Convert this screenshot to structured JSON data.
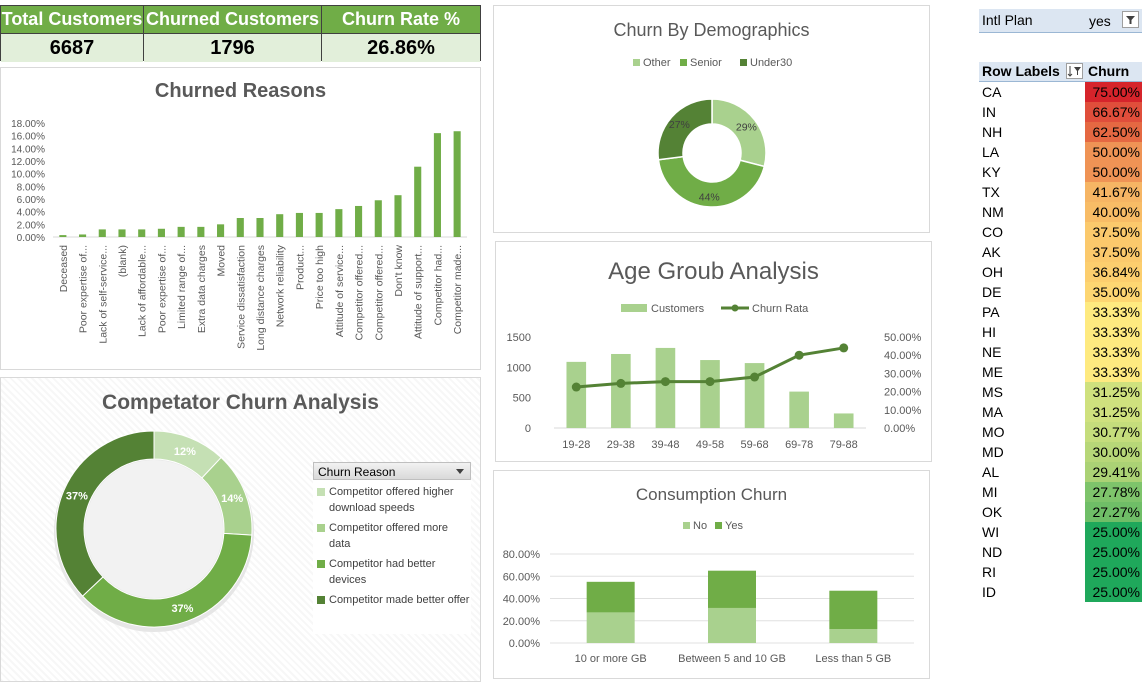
{
  "kpis": [
    {
      "label": "Total Customers",
      "value": "6687"
    },
    {
      "label": "Churned Customers",
      "value": "1796"
    },
    {
      "label": "Churn Rate %",
      "value": "26.86%"
    }
  ],
  "filter": {
    "label": "Intl Plan",
    "value": "yes"
  },
  "pivot": {
    "header_row": "Row Labels",
    "header_value": "Churn",
    "rows": [
      {
        "state": "CA",
        "value": "75.00%",
        "color": "#d6242b"
      },
      {
        "state": "IN",
        "value": "66.67%",
        "color": "#e04e3b"
      },
      {
        "state": "NH",
        "value": "62.50%",
        "color": "#e56842"
      },
      {
        "state": "LA",
        "value": "50.00%",
        "color": "#ef9355"
      },
      {
        "state": "KY",
        "value": "50.00%",
        "color": "#ef9355"
      },
      {
        "state": "TX",
        "value": "41.67%",
        "color": "#f6b564"
      },
      {
        "state": "NM",
        "value": "40.00%",
        "color": "#f8bc66"
      },
      {
        "state": "CO",
        "value": "37.50%",
        "color": "#fbc96c"
      },
      {
        "state": "AK",
        "value": "37.50%",
        "color": "#fbc96c"
      },
      {
        "state": "OH",
        "value": "36.84%",
        "color": "#fcce6e"
      },
      {
        "state": "DE",
        "value": "35.00%",
        "color": "#fdd672"
      },
      {
        "state": "PA",
        "value": "33.33%",
        "color": "#feea80"
      },
      {
        "state": "HI",
        "value": "33.33%",
        "color": "#feea80"
      },
      {
        "state": "NE",
        "value": "33.33%",
        "color": "#feea80"
      },
      {
        "state": "ME",
        "value": "33.33%",
        "color": "#feea80"
      },
      {
        "state": "MS",
        "value": "31.25%",
        "color": "#cfe17e"
      },
      {
        "state": "MA",
        "value": "31.25%",
        "color": "#cfe17e"
      },
      {
        "state": "MO",
        "value": "30.77%",
        "color": "#c5dd7c"
      },
      {
        "state": "MD",
        "value": "30.00%",
        "color": "#b7d778"
      },
      {
        "state": "AL",
        "value": "29.41%",
        "color": "#abd275"
      },
      {
        "state": "MI",
        "value": "27.78%",
        "color": "#7ec46b"
      },
      {
        "state": "OK",
        "value": "27.27%",
        "color": "#6fbe67"
      },
      {
        "state": "WI",
        "value": "25.00%",
        "color": "#1fa85b"
      },
      {
        "state": "ND",
        "value": "25.00%",
        "color": "#1fa85b"
      },
      {
        "state": "RI",
        "value": "25.00%",
        "color": "#1fa85b"
      },
      {
        "state": "ID",
        "value": "25.00%",
        "color": "#1fa85b"
      }
    ]
  },
  "chart_data": [
    {
      "id": "churned_reasons",
      "type": "bar",
      "title": "Churned Reasons",
      "color": "#70ad47",
      "categories": [
        "Deceased",
        "Poor expertise of...",
        "Lack of self-service...",
        "(blank)",
        "Lack of affordable...",
        "Poor expertise of...",
        "Limited range of...",
        "Extra data charges",
        "Moved",
        "Service dissatisfaction",
        "Long distance charges",
        "Network reliability",
        "Product...",
        "Price too high",
        "Attitude of service...",
        "Competitor offered...",
        "Competitor offered...",
        "Don't know",
        "Attitude of support...",
        "Competitor had...",
        "Competitor made..."
      ],
      "values": [
        0.3,
        0.4,
        1.2,
        1.2,
        1.2,
        1.3,
        1.6,
        1.6,
        2.0,
        3.0,
        3.0,
        3.6,
        3.8,
        3.8,
        4.4,
        4.9,
        5.8,
        6.6,
        11.1,
        16.4,
        16.7
      ],
      "ylim": [
        0,
        18
      ],
      "yticks": [
        "0.00%",
        "2.00%",
        "4.00%",
        "6.00%",
        "8.00%",
        "10.00%",
        "12.00%",
        "14.00%",
        "16.00%",
        "18.00%"
      ],
      "grid": false
    },
    {
      "id": "churn_by_demographics",
      "type": "pie",
      "title": "Churn By Demographics",
      "legend": [
        "Other",
        "Senior",
        "Under30"
      ],
      "values": [
        29,
        44,
        27
      ],
      "labels": [
        "29%",
        "44%",
        "27%"
      ],
      "colors": [
        "#a9d18e",
        "#70ad47",
        "#548235"
      ]
    },
    {
      "id": "age_group_analysis",
      "type": "bar",
      "title": "Age Groub Analysis",
      "categories": [
        "19-28",
        "29-38",
        "39-48",
        "49-58",
        "59-68",
        "69-78",
        "79-88"
      ],
      "series": [
        {
          "name": "Customers",
          "type": "bar",
          "axis": "left",
          "values": [
            1090,
            1220,
            1320,
            1120,
            1070,
            600,
            240
          ],
          "color": "#a9d18e"
        },
        {
          "name": "Churn Rata",
          "type": "line",
          "axis": "right",
          "values": [
            22.5,
            24.5,
            25.5,
            25.5,
            28.0,
            40.0,
            44.0
          ],
          "color": "#548235"
        }
      ],
      "ylim_left": [
        0,
        1500
      ],
      "yticks_left": [
        "0",
        "500",
        "1000",
        "1500"
      ],
      "ylim_right": [
        0,
        50
      ],
      "yticks_right": [
        "0.00%",
        "10.00%",
        "20.00%",
        "30.00%",
        "40.00%",
        "50.00%"
      ]
    },
    {
      "id": "consumption_churn",
      "type": "bar",
      "stacked": true,
      "title": "Consumption Churn",
      "categories": [
        "10 or more GB",
        "Between 5 and 10 GB",
        "Less than 5 GB"
      ],
      "series": [
        {
          "name": "No",
          "values": [
            27.5,
            31.5,
            12.5
          ],
          "color": "#a9d18e"
        },
        {
          "name": "Yes",
          "values": [
            27.5,
            33.5,
            34.5
          ],
          "color": "#70ad47"
        }
      ],
      "ylim": [
        0,
        80
      ],
      "yticks": [
        "0.00%",
        "20.00%",
        "40.00%",
        "60.00%",
        "80.00%"
      ]
    },
    {
      "id": "competitor_churn",
      "type": "pie",
      "title": "Competator Churn Analysis",
      "legend_title": "Churn Reason",
      "legend": [
        "Competitor offered higher download speeds",
        "Competitor offered more data",
        "Competitor had better devices",
        "Competitor made better offer"
      ],
      "values": [
        12,
        14,
        37,
        37
      ],
      "labels": [
        "12%",
        "14%",
        "37%",
        "37%"
      ],
      "colors": [
        "#c5e0b4",
        "#a9d18e",
        "#70ad47",
        "#548235"
      ]
    }
  ]
}
